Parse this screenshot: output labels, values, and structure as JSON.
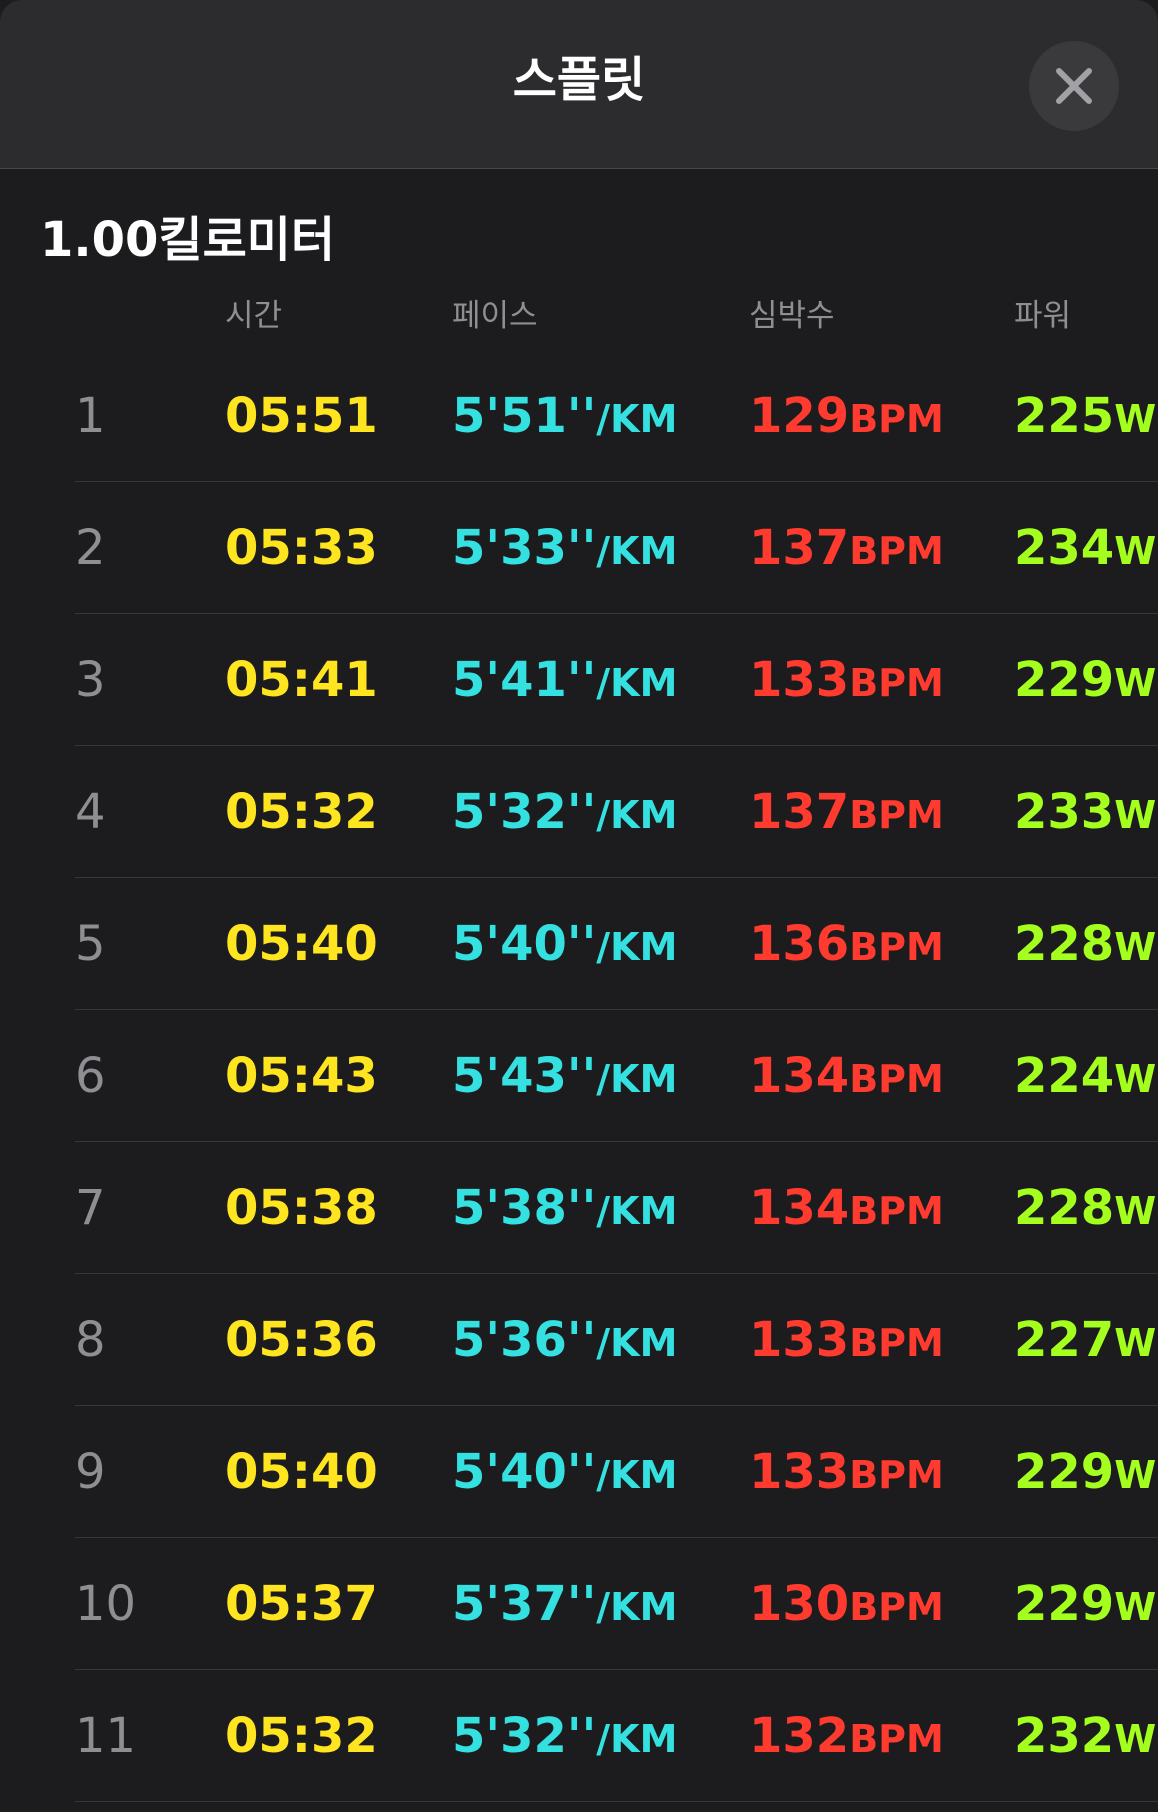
{
  "header": {
    "title": "스플릿",
    "close_icon": "close-icon"
  },
  "section": {
    "title": "1.00킬로미터"
  },
  "columns": {
    "time": "시간",
    "pace": "페이스",
    "heart_rate": "심박수",
    "power": "파워"
  },
  "units": {
    "pace": "/KM",
    "heart_rate": "BPM",
    "power": "W"
  },
  "colors": {
    "time": "#ffe51f",
    "pace": "#35e0e0",
    "heart_rate": "#ff3b30",
    "power": "#a4ff1e"
  },
  "splits": [
    {
      "index": "1",
      "time": "05:51",
      "pace": "5'51''",
      "heart_rate": "129",
      "power": "225"
    },
    {
      "index": "2",
      "time": "05:33",
      "pace": "5'33''",
      "heart_rate": "137",
      "power": "234"
    },
    {
      "index": "3",
      "time": "05:41",
      "pace": "5'41''",
      "heart_rate": "133",
      "power": "229"
    },
    {
      "index": "4",
      "time": "05:32",
      "pace": "5'32''",
      "heart_rate": "137",
      "power": "233"
    },
    {
      "index": "5",
      "time": "05:40",
      "pace": "5'40''",
      "heart_rate": "136",
      "power": "228"
    },
    {
      "index": "6",
      "time": "05:43",
      "pace": "5'43''",
      "heart_rate": "134",
      "power": "224"
    },
    {
      "index": "7",
      "time": "05:38",
      "pace": "5'38''",
      "heart_rate": "134",
      "power": "228"
    },
    {
      "index": "8",
      "time": "05:36",
      "pace": "5'36''",
      "heart_rate": "133",
      "power": "227"
    },
    {
      "index": "9",
      "time": "05:40",
      "pace": "5'40''",
      "heart_rate": "133",
      "power": "229"
    },
    {
      "index": "10",
      "time": "05:37",
      "pace": "5'37''",
      "heart_rate": "130",
      "power": "229"
    },
    {
      "index": "11",
      "time": "05:32",
      "pace": "5'32''",
      "heart_rate": "132",
      "power": "232"
    }
  ]
}
